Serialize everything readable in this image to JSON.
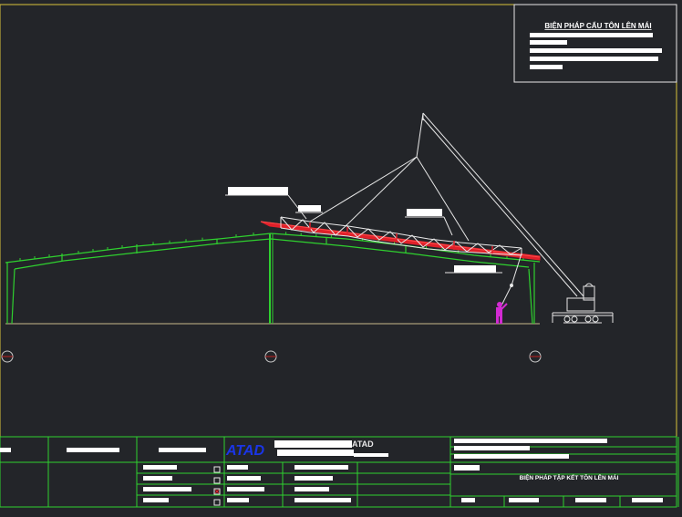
{
  "title_block": {
    "heading": "BIỆN PHÁP CẨU TÔN LÊN MÁI"
  },
  "bottom_block": {
    "logo": "ATAD",
    "company": "ATAD",
    "drawing_title": "BIỆN PHÁP TẬP KẾT TÔN LÊN MÁI"
  },
  "colors": {
    "background": "#232529",
    "frame": "#2fd12f",
    "roof_sheet": "#e0202a",
    "worker": "#d22ad2",
    "crane": "#e8e8e8",
    "border": "#d8c43a",
    "logo": "#1a35e6"
  },
  "icons": [
    "grid-axis-marker",
    "checkbox-icon",
    "crane-icon",
    "worker-icon"
  ]
}
